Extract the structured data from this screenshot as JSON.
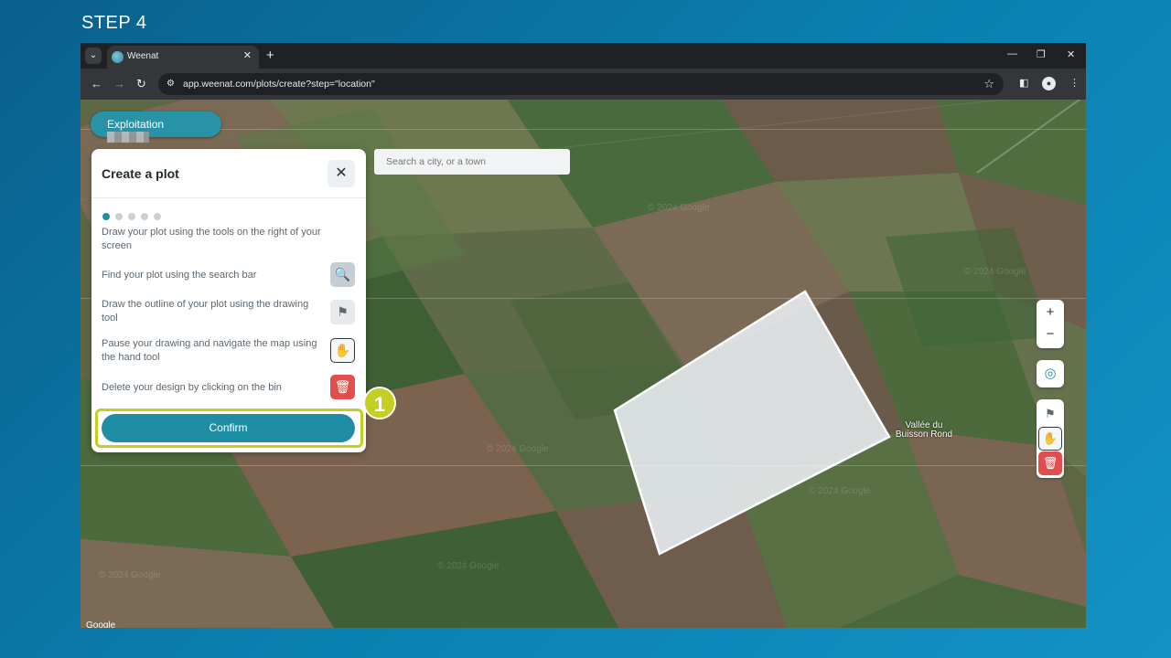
{
  "step_title": "STEP 4",
  "browser": {
    "tab_title": "Weenat",
    "tab_close": "✕",
    "new_tab": "+",
    "tab_menu": "⌄",
    "win_minimize": "—",
    "win_restore": "❐",
    "win_close": "✕",
    "back": "←",
    "forward": "→",
    "reload": "↻",
    "site_info": "⚙",
    "url": "app.weenat.com/plots/create?step=\"location\"",
    "bookmark_star": "☆",
    "side_panel": "◧",
    "profile": "●",
    "menu": "⋮"
  },
  "exploitation_label": "Exploitation",
  "panel": {
    "title": "Create a plot",
    "close": "✕",
    "steps_total": 5,
    "steps_current": 1,
    "intro": "Draw your plot using the tools on the right of your screen",
    "instructions": [
      {
        "text": "Find your plot using the search bar",
        "icon": "search-map-icon",
        "glyph": "🔍"
      },
      {
        "text": "Draw the outline of your plot using the drawing tool",
        "icon": "draw-polygon-icon",
        "glyph": "⚑"
      },
      {
        "text": "Pause your drawing and navigate the map using the hand tool",
        "icon": "hand-icon",
        "glyph": "✋"
      },
      {
        "text": "Delete your design by clicking on the bin",
        "icon": "trash-icon",
        "glyph": "🗑"
      }
    ],
    "confirm_label": "Confirm"
  },
  "callout_number": "1",
  "search": {
    "placeholder": "Search a city, or a town"
  },
  "map": {
    "place_label": "Vallée du Buisson Rond",
    "watermark": "© 2024 Google",
    "google_text": "Google"
  },
  "map_controls": {
    "zoom_in": "+",
    "zoom_out": "−",
    "locate": "◎",
    "draw": "⚑",
    "hand": "✋",
    "bin": "🗑"
  },
  "colors": {
    "accent": "#1f8ea4",
    "highlight": "#c3cf21",
    "danger": "#e24d4d"
  }
}
